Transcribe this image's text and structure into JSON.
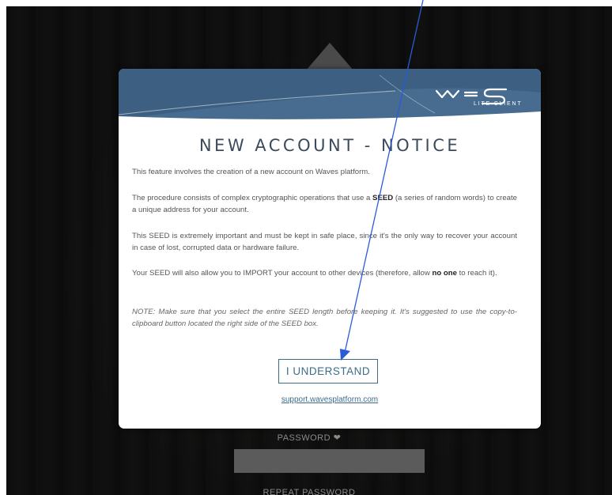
{
  "background": {
    "password_label": "PASSWORD ❤",
    "repeat_password_label": "REPEAT PASSWORD"
  },
  "modal": {
    "logo_label": "LITE CLIENT",
    "title": "NEW ACCOUNT - NOTICE",
    "p1": "This feature involves the creation of a new account on Waves platform.",
    "p2_before": "The procedure consists of complex cryptographic operations that use a ",
    "p2_bold": "SEED",
    "p2_after": " (a series of random words) to create a unique address for your account.",
    "p3": "This SEED is extremely important and must be kept in safe place, since it's the only way to recover your account in case of lost, corrupted data or hardware failure.",
    "p4_before": "Your SEED will also allow you to IMPORT your account to other devices (therefore, allow ",
    "p4_bold": "no one",
    "p4_after": " to reach it).",
    "p5": "NOTE: Make sure that you select the entire SEED length before keeping it. It's suggested to use the copy-to-clipboard button located the right side of the SEED box.",
    "button_label": "I UNDERSTAND",
    "support_link": "support.wavesplatform.com"
  },
  "colors": {
    "header": "#3d6082",
    "accent": "#3d6c88",
    "annotation_arrow": "#2a5bd7"
  }
}
